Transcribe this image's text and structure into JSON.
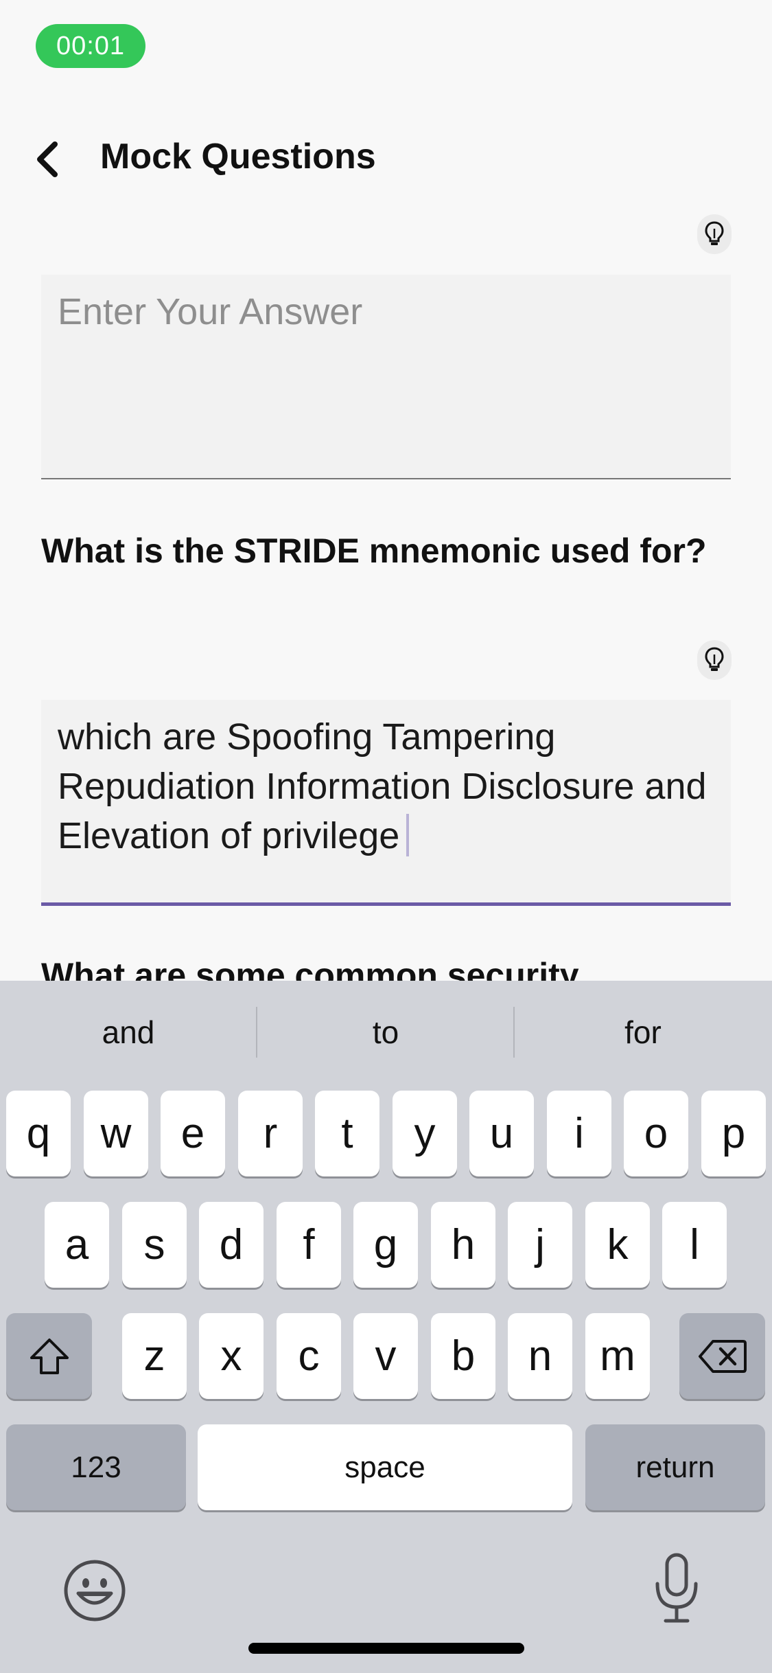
{
  "status": {
    "timer": "00:01"
  },
  "nav": {
    "back_icon": "chevron-left-icon",
    "title": "Mock Questions"
  },
  "answers": [
    {
      "placeholder": "Enter Your Answer",
      "value": ""
    },
    {
      "placeholder": "Enter Your Answer",
      "value": "which are Spoofing Tampering Repudiation Information Disclosure and Elevation of privilege"
    }
  ],
  "questions": [
    {
      "text": "What is the STRIDE mnemonic used for?"
    },
    {
      "text": "What are some common security"
    }
  ],
  "hint_icon": "lightbulb-icon",
  "keyboard": {
    "suggestions": [
      "and",
      "to",
      "for"
    ],
    "row1": [
      "q",
      "w",
      "e",
      "r",
      "t",
      "y",
      "u",
      "i",
      "o",
      "p"
    ],
    "row2": [
      "a",
      "s",
      "d",
      "f",
      "g",
      "h",
      "j",
      "k",
      "l"
    ],
    "row3": [
      "z",
      "x",
      "c",
      "v",
      "b",
      "n",
      "m"
    ],
    "numbers_label": "123",
    "space_label": "space",
    "return_label": "return",
    "shift_icon": "shift-icon",
    "delete_icon": "delete-icon",
    "emoji_icon": "emoji-icon",
    "mic_icon": "microphone-icon"
  },
  "colors": {
    "timer_bg": "#34c759",
    "active_underline": "#6b5aa6",
    "keyboard_bg": "#d1d3d9"
  }
}
